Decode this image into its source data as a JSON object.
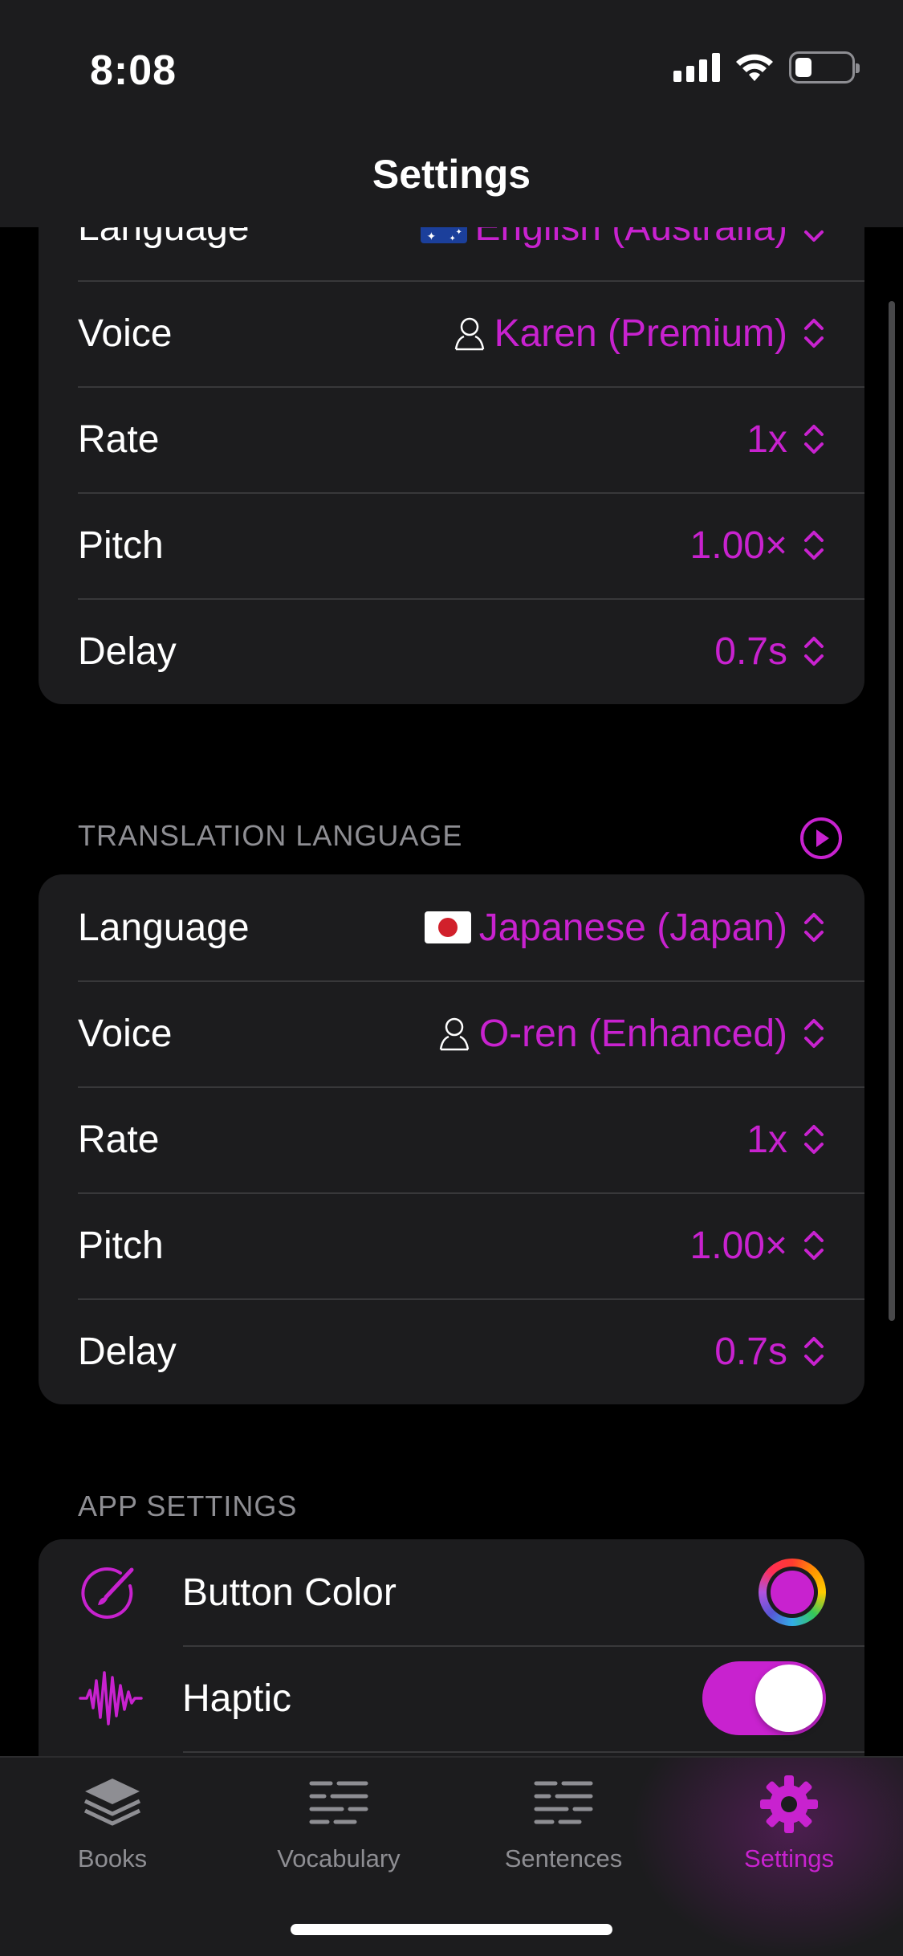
{
  "status_bar": {
    "time": "8:08"
  },
  "header": {
    "title": "Settings"
  },
  "accent_color": "#c822cf",
  "source_language": {
    "rows": [
      {
        "label": "Language",
        "value": "English (Australia)",
        "flag": "flag-australia"
      },
      {
        "label": "Voice",
        "value": "Karen (Premium)",
        "icon": "person-icon"
      },
      {
        "label": "Rate",
        "value": "1x"
      },
      {
        "label": "Pitch",
        "value": "1.00×"
      },
      {
        "label": "Delay",
        "value": "0.7s"
      }
    ]
  },
  "translation_language": {
    "header": "TRANSLATION LANGUAGE",
    "rows": [
      {
        "label": "Language",
        "value": "Japanese (Japan)",
        "flag": "flag-japan"
      },
      {
        "label": "Voice",
        "value": "O-ren (Enhanced)",
        "icon": "person-icon"
      },
      {
        "label": "Rate",
        "value": "1x"
      },
      {
        "label": "Pitch",
        "value": "1.00×"
      },
      {
        "label": "Delay",
        "value": "0.7s"
      }
    ]
  },
  "app_settings": {
    "header": "APP SETTINGS",
    "rows": [
      {
        "label": "Button Color",
        "icon": "paintbrush-icon",
        "control": "color-well"
      },
      {
        "label": "Haptic",
        "icon": "waveform-icon",
        "control": "toggle",
        "on": true
      }
    ]
  },
  "tab_bar": {
    "tabs": [
      {
        "label": "Books",
        "icon": "books-stack-icon",
        "active": false
      },
      {
        "label": "Vocabulary",
        "icon": "text-list-icon",
        "active": false
      },
      {
        "label": "Sentences",
        "icon": "text-list-icon",
        "active": false
      },
      {
        "label": "Settings",
        "icon": "gear-icon",
        "active": true
      }
    ]
  }
}
